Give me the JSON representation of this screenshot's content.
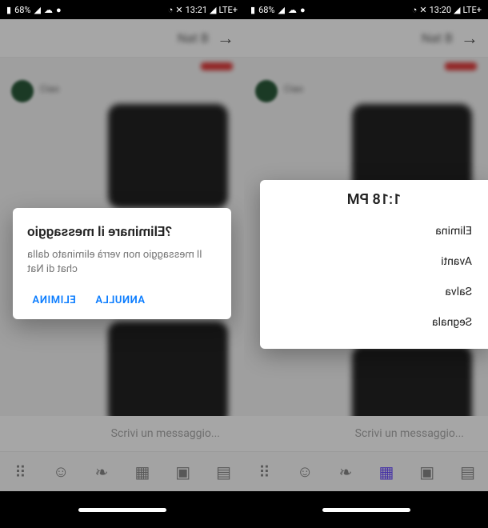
{
  "left": {
    "status": {
      "time": "13:21",
      "battery": "68%",
      "network": "LTE+"
    },
    "chat": {
      "name": "Nat B",
      "cta_label": "Ciao"
    },
    "dialog": {
      "title": "Eliminare il messaggio?",
      "body": "Il messaggio non verrà eliminato dalla chat di Nat",
      "confirm": "ELIMINA",
      "cancel": "ANNULLA"
    },
    "composer": {
      "placeholder": "Scrivi un messaggio..."
    }
  },
  "right": {
    "status": {
      "time": "13:20",
      "battery": "68%",
      "network": "LTE+"
    },
    "chat": {
      "name": "Nat B",
      "cta_label": "Ciao"
    },
    "context": {
      "timestamp": "1:18 PM",
      "items": [
        "Elimina",
        "Avanti",
        "Salva",
        "Segnala"
      ]
    },
    "composer": {
      "placeholder": "Scrivi un messaggio..."
    }
  }
}
